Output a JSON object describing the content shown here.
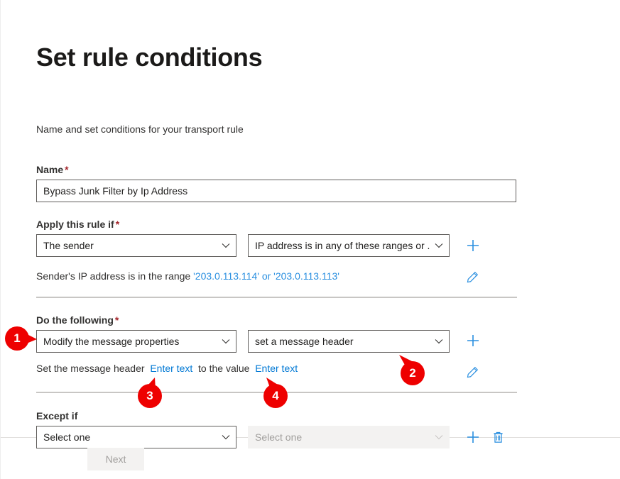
{
  "page": {
    "title": "Set rule conditions",
    "subtitle": "Name and set conditions for your transport rule"
  },
  "name_field": {
    "label": "Name",
    "required_mark": "*",
    "value": "Bypass Junk Filter by Ip Address"
  },
  "apply_rule": {
    "label": "Apply this rule if",
    "required_mark": "*",
    "condition_select": "The sender",
    "predicate_select": "IP address is in any of these ranges or ...",
    "summary_prefix": "Sender's IP address is in the range",
    "summary_value_1": "'203.0.113.114'",
    "summary_conjunction": "or",
    "summary_value_2": "'203.0.113.113'"
  },
  "do_following": {
    "label": "Do the following",
    "required_mark": "*",
    "action_select": "Modify the message properties",
    "action_detail_select": "set a message header",
    "summary_prefix": "Set the message header",
    "summary_link_1": "Enter text",
    "summary_middle": "to the value",
    "summary_link_2": "Enter text"
  },
  "except_if": {
    "label": "Except if",
    "condition_select": "Select one",
    "predicate_select": "Select one"
  },
  "footer": {
    "next_label": "Next"
  },
  "callouts": [
    {
      "number": "1"
    },
    {
      "number": "2"
    },
    {
      "number": "3"
    },
    {
      "number": "4"
    }
  ],
  "colors": {
    "callout_red": "#ee0000",
    "link_blue": "#0078d4",
    "icon_blue": "#2a8fe0",
    "required_red": "#a4262c",
    "border_gray": "#605e5c"
  }
}
